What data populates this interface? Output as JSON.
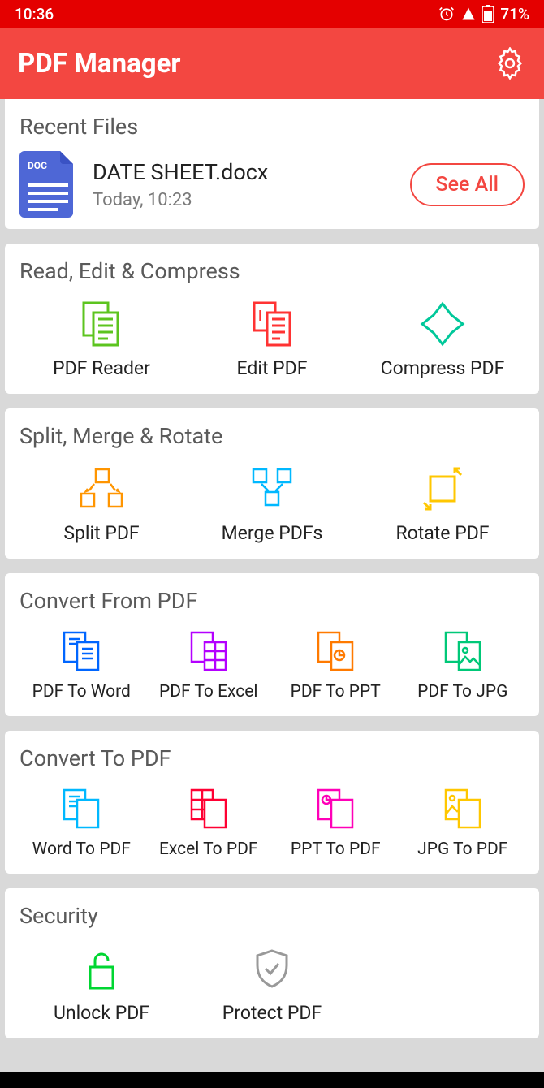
{
  "status": {
    "time": "10:36",
    "battery": "71%"
  },
  "header": {
    "title": "PDF Manager"
  },
  "recent": {
    "title": "Recent Files",
    "file_name": "DATE SHEET.docx",
    "file_time": "Today,  10:23",
    "see_all": "See All"
  },
  "sections": {
    "readEdit": {
      "title": "Read, Edit & Compress",
      "items": [
        {
          "label": "PDF Reader"
        },
        {
          "label": "Edit PDF"
        },
        {
          "label": "Compress PDF"
        }
      ]
    },
    "splitMerge": {
      "title": "Split, Merge & Rotate",
      "items": [
        {
          "label": "Split PDF"
        },
        {
          "label": "Merge PDFs"
        },
        {
          "label": "Rotate PDF"
        }
      ]
    },
    "convertFrom": {
      "title": "Convert From PDF",
      "items": [
        {
          "label": "PDF To Word"
        },
        {
          "label": "PDF To Excel"
        },
        {
          "label": "PDF To PPT"
        },
        {
          "label": "PDF To JPG"
        }
      ]
    },
    "convertTo": {
      "title": "Convert To PDF",
      "items": [
        {
          "label": "Word To PDF"
        },
        {
          "label": "Excel To PDF"
        },
        {
          "label": "PPT To PDF"
        },
        {
          "label": "JPG To PDF"
        }
      ]
    },
    "security": {
      "title": "Security",
      "items": [
        {
          "label": "Unlock PDF"
        },
        {
          "label": "Protect PDF"
        }
      ]
    }
  }
}
